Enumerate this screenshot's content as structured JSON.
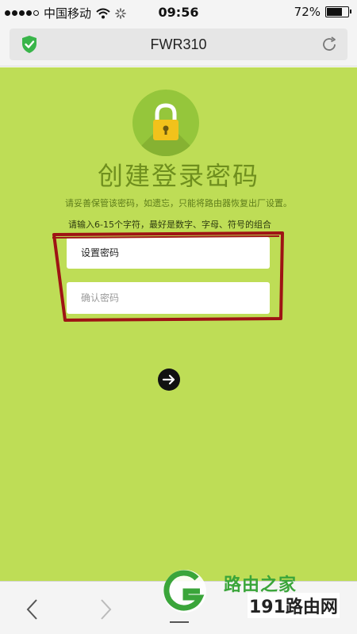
{
  "status_bar": {
    "carrier": "中国移动",
    "time": "09:56",
    "battery": "72%",
    "battery_level": 0.72
  },
  "browser": {
    "host": "FWR310",
    "icons": {
      "security": "shield-check-icon",
      "reload": "reload-icon"
    }
  },
  "page": {
    "title": "创建登录密码",
    "subtitle": "请妥善保管该密码，如遗忘，只能将路由器恢复出厂设置。",
    "hint": "请输入6-15个字符，最好是数字、字母、符号的组合",
    "password_placeholder": "设置密码",
    "confirm_placeholder": "确认密码",
    "icons": {
      "lock": "padlock-icon",
      "next": "arrow-right-icon"
    }
  },
  "colors": {
    "page_background": "#bedd56",
    "accent_green": "#95c63b",
    "title_color": "#6f8f1e",
    "annotation": "#9e1414"
  },
  "watermark": {
    "text_top": "路由之家",
    "text_bottom": "191路由网"
  },
  "nav": {
    "icons": {
      "back": "chevron-left-icon",
      "forward": "chevron-right-icon",
      "menu": "menu-icon"
    }
  }
}
